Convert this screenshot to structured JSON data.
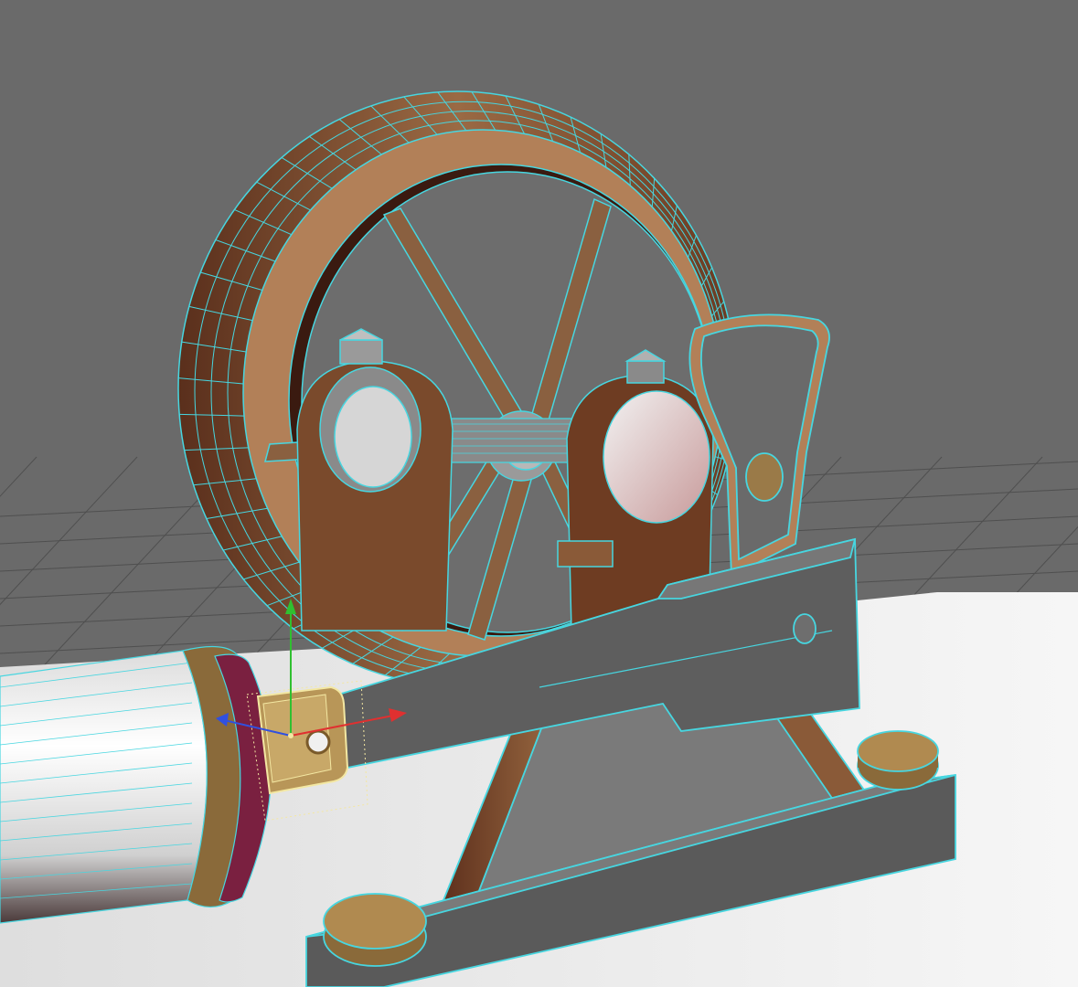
{
  "viewport": {
    "background_color": "#6a6a6a",
    "grid_color": "#4f4f4f",
    "wire_color": "#47d6e0",
    "selection_color": "#f3e7a2"
  },
  "scene": {
    "objects": [
      {
        "name": "flywheel",
        "material_color": "#8a5a3a"
      },
      {
        "name": "crank-shaft",
        "material_color": "#7c7c7c"
      },
      {
        "name": "bearing-block-left",
        "material_color": "#7a4a2c"
      },
      {
        "name": "bearing-block-right",
        "material_color": "#7a4a2c"
      },
      {
        "name": "a-frame-stand",
        "material_color": "#8a5a38"
      },
      {
        "name": "connecting-rod",
        "material_color": "#5e5e5e"
      },
      {
        "name": "crank-arm",
        "material_color": "#6a6a6a"
      },
      {
        "name": "base-plate",
        "material_color": "#5a5a5a"
      },
      {
        "name": "cylinder",
        "material_color": "#f2f2f2"
      },
      {
        "name": "cross-head",
        "material_color": "#b89658",
        "selected": true
      }
    ]
  },
  "gizmo": {
    "axes": [
      {
        "name": "x-axis",
        "color": "#e03030"
      },
      {
        "name": "y-axis",
        "color": "#30c030"
      },
      {
        "name": "z-axis",
        "color": "#3050e0"
      }
    ]
  }
}
